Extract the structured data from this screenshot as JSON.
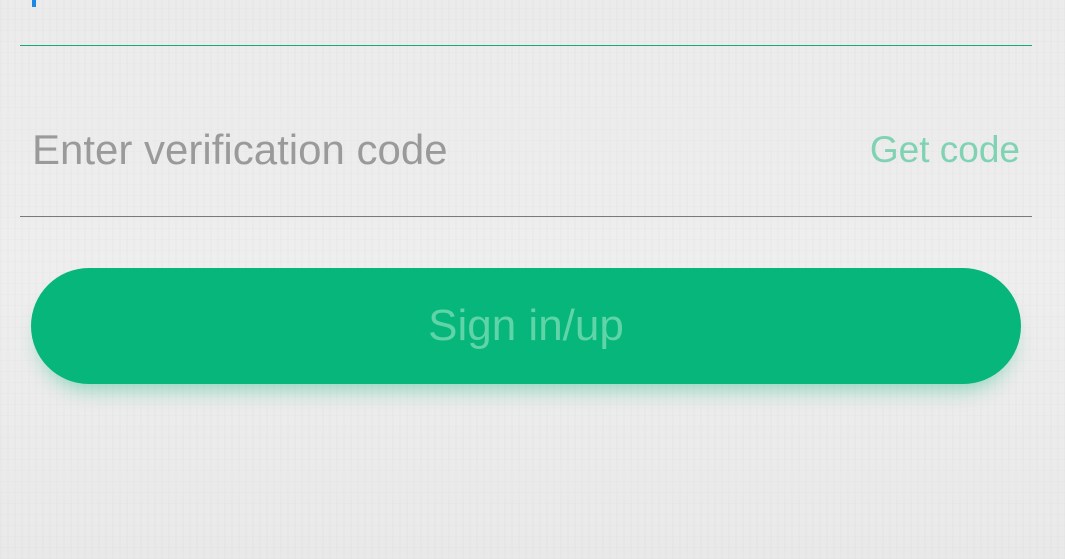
{
  "phone_field": {
    "value": ""
  },
  "code_field": {
    "placeholder": "Enter verification code",
    "value": "",
    "get_code_label": "Get code"
  },
  "submit": {
    "label": "Sign in/up"
  },
  "colors": {
    "accent": "#07b67a",
    "accent_text_disabled": "#7fd3b3",
    "cursor": "#1e88e5",
    "background": "#ececec"
  }
}
